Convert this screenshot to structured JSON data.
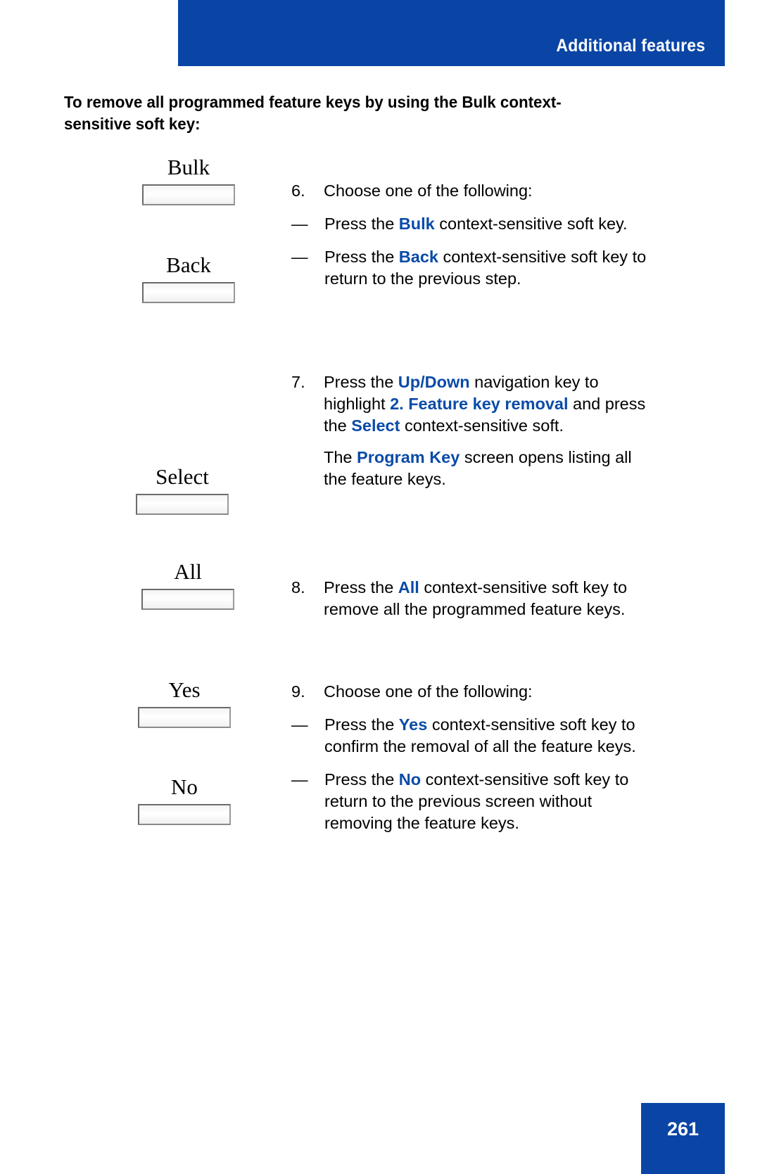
{
  "header": {
    "title": "Additional features",
    "banner_color": "#0A45A5"
  },
  "section": {
    "heading": "To remove all programmed feature keys by using the Bulk context-sensitive soft key:"
  },
  "softkeys": [
    {
      "label": "Bulk",
      "name": "softkey-bulk"
    },
    {
      "label": "Back",
      "name": "softkey-back"
    },
    {
      "label": "Select",
      "name": "softkey-select"
    },
    {
      "label": "All",
      "name": "softkey-all"
    },
    {
      "label": "Yes",
      "name": "softkey-yes"
    },
    {
      "label": "No",
      "name": "softkey-no"
    }
  ],
  "steps": {
    "step6": {
      "number": "6.",
      "text": "Choose one of the following:",
      "sub1_dash": "—",
      "sub1_a": "Press the ",
      "sub1_kw": "Bulk",
      "sub1_b": " context-sensitive soft key.",
      "sub2_dash": "—",
      "sub2_a": "Press the ",
      "sub2_kw": "Back",
      "sub2_b": " context-sensitive soft key to return to the previous step."
    },
    "step7": {
      "number": "7.",
      "a": "Press the ",
      "kw1": "Up/Down",
      "b": " navigation key to highlight ",
      "kw2": "2. Feature key removal",
      "c": " and press the ",
      "kw3": "Select",
      "d": " context-sensitive soft.",
      "note_a": "The ",
      "note_kw": "Program Key",
      "note_b": " screen opens listing all the feature keys."
    },
    "step8": {
      "number": "8.",
      "a": "Press the ",
      "kw": "All",
      "b": " context-sensitive soft key to remove all the programmed feature keys."
    },
    "step9": {
      "number": "9.",
      "text": "Choose one of the following:",
      "sub1_dash": "—",
      "sub1_a": "Press the ",
      "sub1_kw": "Yes",
      "sub1_b": " context-sensitive soft key to confirm the removal of all the feature keys.",
      "sub2_dash": "—",
      "sub2_a": "Press the ",
      "sub2_kw": "No",
      "sub2_b": " context-sensitive soft key to return to the previous screen without removing the feature keys."
    }
  },
  "footer": {
    "page_number": "261",
    "box_color": "#0A45A5"
  }
}
